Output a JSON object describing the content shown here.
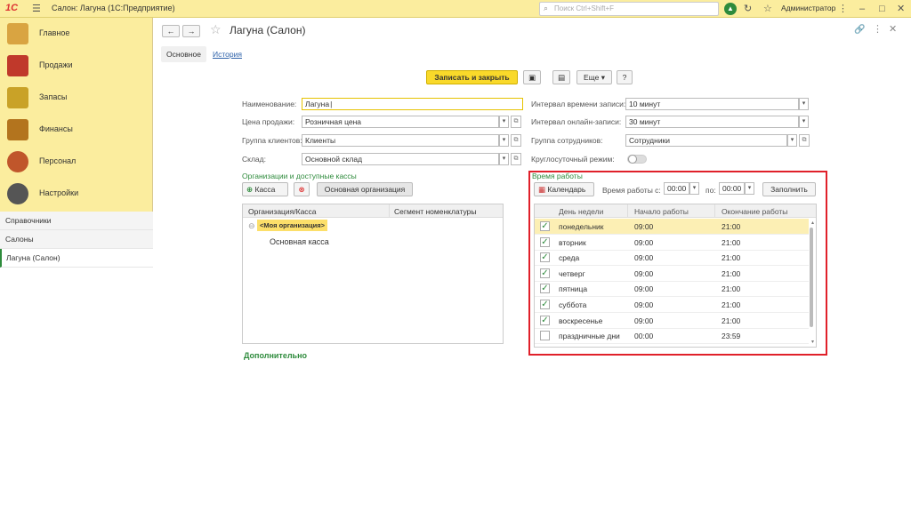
{
  "app": {
    "title": "Салон: Лагуна  (1С:Предприятие)",
    "logo": "1С",
    "search_placeholder": "Поиск Ctrl+Shift+F",
    "user": "Администратор"
  },
  "sidebar": {
    "sections": [
      {
        "label": "Главное",
        "icon": "home-icon",
        "color": "#d9a441"
      },
      {
        "label": "Продажи",
        "icon": "sales-chart-icon",
        "color": "#c0392b"
      },
      {
        "label": "Запасы",
        "icon": "boxes-icon",
        "color": "#c9a227"
      },
      {
        "label": "Финансы",
        "icon": "wallet-icon",
        "color": "#b3741e"
      },
      {
        "label": "Персонал",
        "icon": "people-icon",
        "color": "#c0562b"
      },
      {
        "label": "Настройки",
        "icon": "gear-icon",
        "color": "#555555"
      }
    ],
    "subitems": [
      "Справочники",
      "Салоны",
      "Лагуна (Салон)"
    ]
  },
  "form": {
    "title": "Лагуна (Салон)",
    "tabs": {
      "main": "Основное",
      "history": "История"
    },
    "toolbar": {
      "save_close": "Записать и закрыть",
      "more": "Еще",
      "help": "?"
    },
    "fields": {
      "name_label": "Наименование:",
      "name_value": "Лагуна",
      "price_label": "Цена продажи:",
      "price_value": "Розничная цена",
      "clients_label": "Группа клиентов:",
      "clients_value": "Клиенты",
      "warehouse_label": "Склад:",
      "warehouse_value": "Основной склад",
      "interval_label": "Интервал времени записи:",
      "interval_value": "10 минут",
      "online_label": "Интервал онлайн-записи:",
      "online_value": "30 минут",
      "staff_label": "Группа сотрудников:",
      "staff_value": "Сотрудники",
      "allday_label": "Круглосуточный режим:"
    },
    "orgs": {
      "group_title": "Организации и доступные кассы",
      "add_button": "Касса",
      "main_org_button": "Основная организация",
      "col_org": "Организация/Касса",
      "col_segment": "Сегмент номенклатуры",
      "rows": [
        "<Моя организация>",
        "Основная касса"
      ]
    },
    "worktime": {
      "group_title": "Время работы",
      "calendar_button": "Календарь",
      "from_label": "Время работы с:",
      "from_value": "00:00",
      "to_label": "по:",
      "to_value": "00:00",
      "fill_button": "Заполнить",
      "col_day": "День недели",
      "col_start": "Начало работы",
      "col_end": "Окончание работы",
      "rows": [
        {
          "checked": true,
          "day": "понедельник",
          "start": "09:00",
          "end": "21:00"
        },
        {
          "checked": true,
          "day": "вторник",
          "start": "09:00",
          "end": "21:00"
        },
        {
          "checked": true,
          "day": "среда",
          "start": "09:00",
          "end": "21:00"
        },
        {
          "checked": true,
          "day": "четверг",
          "start": "09:00",
          "end": "21:00"
        },
        {
          "checked": true,
          "day": "пятница",
          "start": "09:00",
          "end": "21:00"
        },
        {
          "checked": true,
          "day": "суббота",
          "start": "09:00",
          "end": "21:00"
        },
        {
          "checked": true,
          "day": "воскресенье",
          "start": "09:00",
          "end": "21:00"
        },
        {
          "checked": false,
          "day": "праздничные дни",
          "start": "00:00",
          "end": "23:59"
        }
      ]
    },
    "additional": "Дополнительно"
  }
}
